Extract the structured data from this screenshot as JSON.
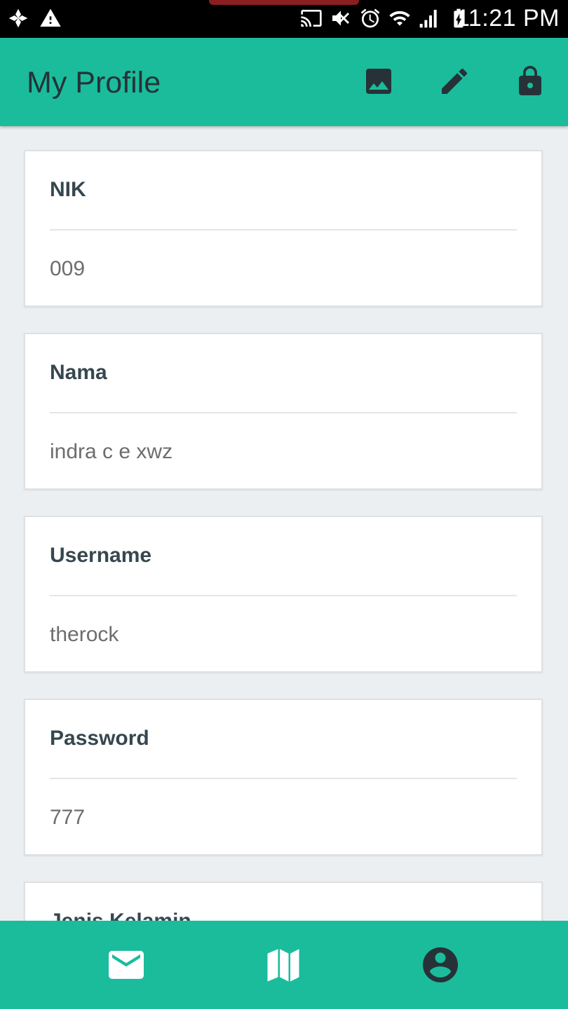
{
  "status_bar": {
    "time": "11:21 PM",
    "icons": [
      "pinwheel-icon",
      "warning-icon",
      "cast-icon",
      "mute-icon",
      "alarm-icon",
      "wifi-icon",
      "signal-icon",
      "battery-charging-icon"
    ]
  },
  "app_bar": {
    "title": "My Profile",
    "actions": [
      "image-icon",
      "edit-icon",
      "lock-icon"
    ]
  },
  "profile_fields": [
    {
      "label": "NIK",
      "value": "009"
    },
    {
      "label": "Nama",
      "value": "indra c e xwz"
    },
    {
      "label": "Username",
      "value": "therock"
    },
    {
      "label": "Password",
      "value": "777"
    },
    {
      "label": "Jenis Kelamin",
      "value": ""
    }
  ],
  "bottom_nav": {
    "items": [
      "mail-icon",
      "map-icon",
      "account-icon"
    ]
  },
  "colors": {
    "primary": "#1abc9c",
    "icon_dark": "#263238",
    "background": "#eceff1",
    "card": "#ffffff"
  }
}
